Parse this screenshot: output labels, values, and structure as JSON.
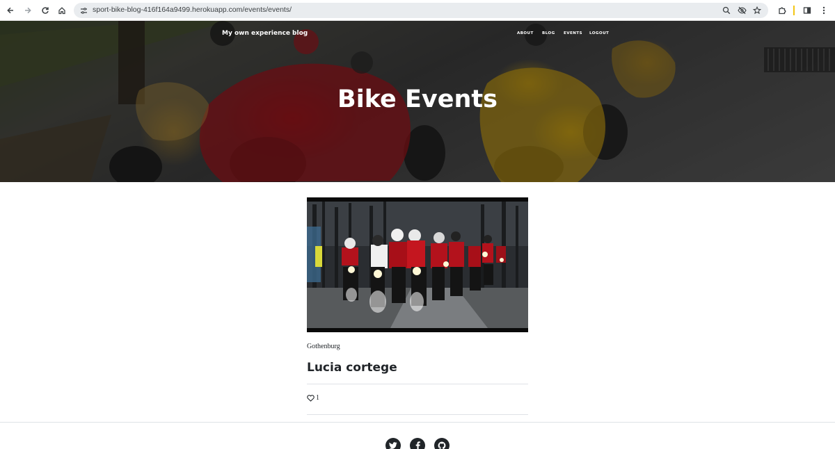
{
  "browser": {
    "url": "sport-bike-blog-416f164a9499.herokuapp.com/events/events/"
  },
  "site": {
    "brand": "My own experience blog",
    "nav": [
      "ABOUT",
      "BLOG",
      "EVENTS",
      "LOGOUT"
    ]
  },
  "hero": {
    "title": "Bike Events"
  },
  "event": {
    "location": "Gothenburg",
    "title": "Lucia cortege",
    "likes": "1"
  },
  "icons": {
    "back": "arrow-left-icon",
    "forward": "arrow-right-icon",
    "reload": "reload-icon",
    "home": "home-icon",
    "site_info": "tune-icon",
    "zoom": "zoom-icon",
    "eye_off": "eye-off-icon",
    "bookmark": "star-icon",
    "extensions": "puzzle-icon",
    "side_panel": "side-panel-icon",
    "menu": "kebab-menu-icon",
    "like": "heart-icon",
    "twitter": "twitter-icon",
    "facebook": "facebook-icon",
    "github": "github-icon"
  },
  "colors": {
    "text": "#212529",
    "divider": "#dee2e6",
    "chrome_bar": "#e9ecef"
  }
}
